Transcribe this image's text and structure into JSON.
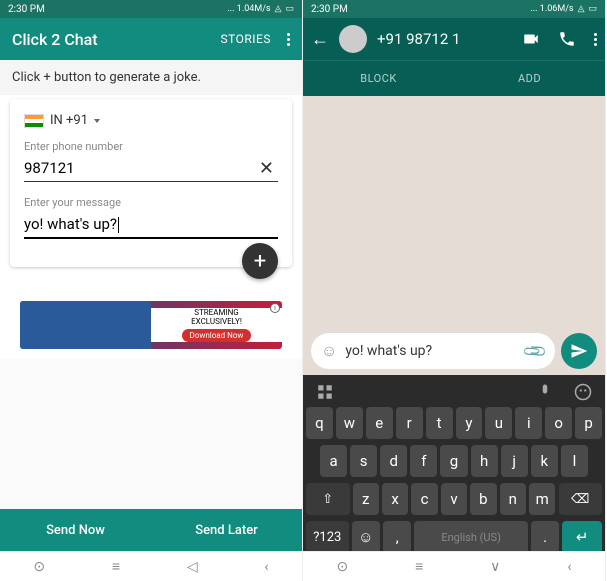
{
  "left": {
    "status": {
      "time": "2:30 PM",
      "speed": "... 1.04M/s"
    },
    "header": {
      "title": "Click 2 Chat",
      "stories": "STORIES"
    },
    "instruction": "Click + button to generate a joke.",
    "card": {
      "country_code": "IN  +91",
      "phone_label": "Enter phone number",
      "phone_value": "987121",
      "msg_label": "Enter your message",
      "msg_value": "yo! what's up?"
    },
    "ad": {
      "line1": "STREAMING",
      "line2": "EXCLUSIVELY!",
      "download": "Download Now"
    },
    "actions": {
      "send_now": "Send Now",
      "send_later": "Send Later"
    }
  },
  "right": {
    "status": {
      "time": "2:30 PM",
      "speed": "... 1.06M/s"
    },
    "header": {
      "phone": "+91 98712 1"
    },
    "chat_actions": {
      "block": "BLOCK",
      "add": "ADD"
    },
    "message": "yo! what's up?",
    "keyboard": {
      "row1": [
        "q",
        "w",
        "e",
        "r",
        "t",
        "y",
        "u",
        "i",
        "o",
        "p"
      ],
      "row2": [
        "a",
        "s",
        "d",
        "f",
        "g",
        "h",
        "j",
        "k",
        "l"
      ],
      "row3": [
        "z",
        "x",
        "c",
        "v",
        "b",
        "n",
        "m"
      ],
      "shift": "⇧",
      "backspace": "⌫",
      "numbers": "?123",
      "space": "English (US)",
      "done": "↵"
    }
  }
}
